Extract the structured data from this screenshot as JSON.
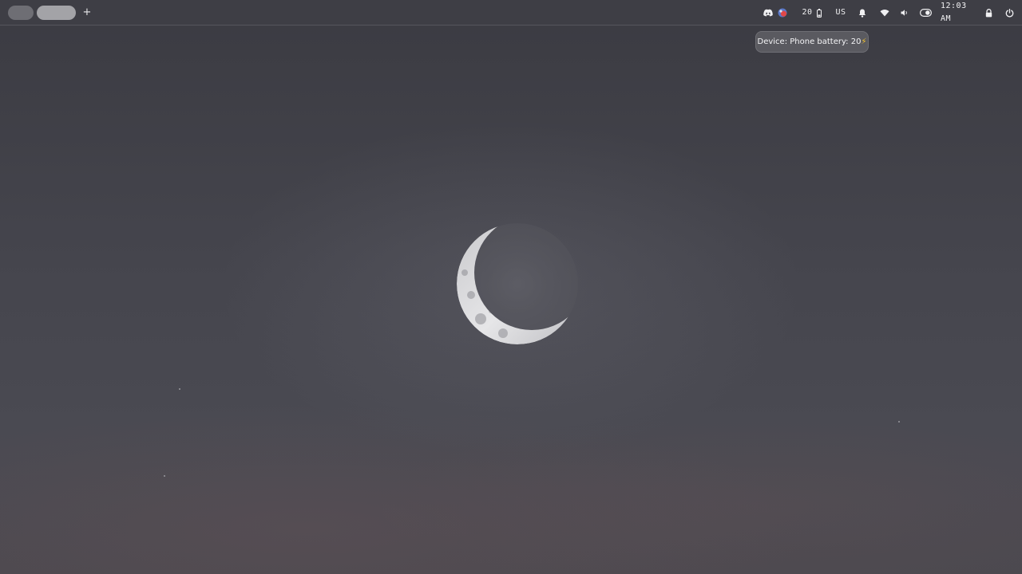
{
  "topbar": {
    "workspace_add_label": "+",
    "battery_value": "20",
    "keyboard_layout": "US",
    "clock": "12:03 AM"
  },
  "tooltip": {
    "text": "Device: Phone battery: 20",
    "bolt": "⚡"
  },
  "icons": {
    "discord": "discord-icon",
    "app_indicator": "app-indicator-icon",
    "battery": "phone-battery-icon",
    "notifications": "bell-icon",
    "wifi": "wifi-icon",
    "volume": "volume-icon",
    "toggle": "toggle-icon",
    "lock": "lock-icon",
    "power": "power-icon"
  },
  "colors": {
    "bar_background": "#3e3e45",
    "workspace_inactive": "#6e6e74",
    "workspace_active": "#a3a3a7",
    "tooltip_background": "#5a5a60",
    "bolt": "#f2c230"
  }
}
